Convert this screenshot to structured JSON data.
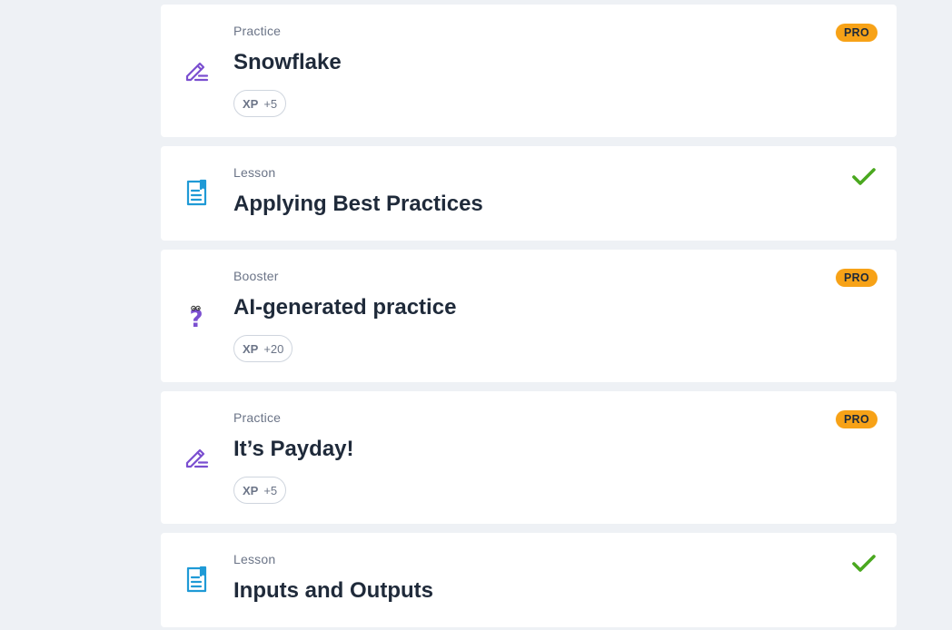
{
  "items": [
    {
      "kind": "Practice",
      "title": "Snowflake",
      "icon": "pencil-icon",
      "badge": "PRO",
      "xp_label": "XP",
      "xp_value": "+5",
      "status": "pro"
    },
    {
      "kind": "Lesson",
      "title": "Applying Best Practices",
      "icon": "document-icon",
      "status": "completed"
    },
    {
      "kind": "Booster",
      "title": "AI-generated practice",
      "icon": "question-icon",
      "badge": "PRO",
      "xp_label": "XP",
      "xp_value": "+20",
      "status": "pro"
    },
    {
      "kind": "Practice",
      "title": "It’s Payday!",
      "icon": "pencil-icon",
      "badge": "PRO",
      "xp_label": "XP",
      "xp_value": "+5",
      "status": "pro"
    },
    {
      "kind": "Lesson",
      "title": "Inputs and Outputs",
      "icon": "document-icon",
      "status": "completed"
    }
  ],
  "colors": {
    "background": "#eef1f5",
    "card": "#ffffff",
    "pro_badge": "#f7a217",
    "check": "#4aa81f",
    "practice_icon": "#7b4fd0",
    "lesson_icon": "#1f9ad6"
  }
}
